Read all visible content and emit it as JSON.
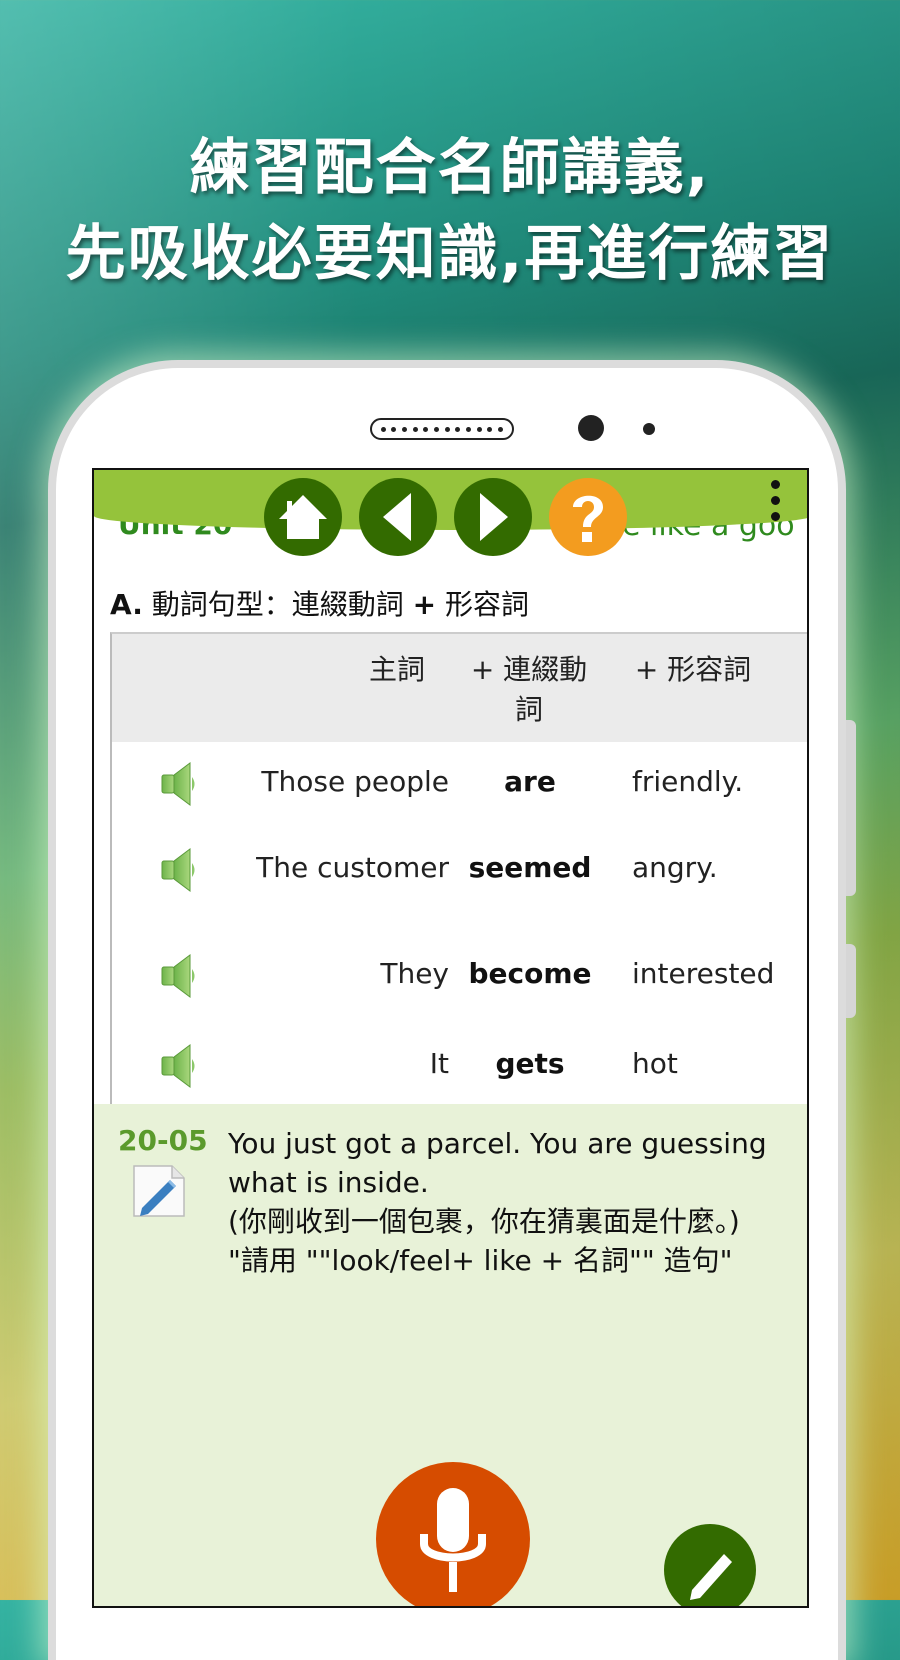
{
  "headline": {
    "line1": "練習配合名師講義,",
    "line2": "先吸收必要知識,再進行練習"
  },
  "app": {
    "header": {
      "unit_title_left": "Unit 20",
      "unit_title_right": "e like a goo",
      "buttons": [
        {
          "name": "home",
          "icon": "home-icon"
        },
        {
          "name": "previous",
          "icon": "triangle-left-icon"
        },
        {
          "name": "next",
          "icon": "triangle-right-icon"
        },
        {
          "name": "help",
          "icon": "question-mark-icon"
        }
      ],
      "menu_icon": "more-vertical-icon",
      "colors": {
        "bar": "#95c33b",
        "nav_button": "#336b00",
        "help_button": "#f39c1f"
      }
    },
    "section": {
      "prefix": "A.",
      "title": "動詞句型：連綴動詞",
      "plus": "+",
      "title_tail": "形容詞"
    },
    "table": {
      "headers": [
        "主詞",
        "+ 連綴動詞",
        "+ 形容詞"
      ],
      "rows": [
        {
          "subject": "Those people",
          "verb": "are",
          "adjective": "friendly."
        },
        {
          "subject": "The customer",
          "verb": "seemed",
          "adjective": "angry."
        },
        {
          "subject": "They",
          "verb": "become",
          "adjective": "interested"
        },
        {
          "subject": "It",
          "verb": "gets",
          "adjective": "hot"
        }
      ]
    },
    "exercise": {
      "number": "20-05",
      "prompt_en": "You just got a parcel. You are guessing what is inside.",
      "prompt_zh": "(你剛收到一個包裹，你在猜裏面是什麼。)",
      "instruction": "\"請用 \"\"look/feel+ like + 名詞\"\" 造句\"",
      "colors": {
        "background": "#e8f2d8",
        "number": "#5b9a2c",
        "mic": "#d64c00",
        "pen": "#336b00"
      }
    }
  }
}
